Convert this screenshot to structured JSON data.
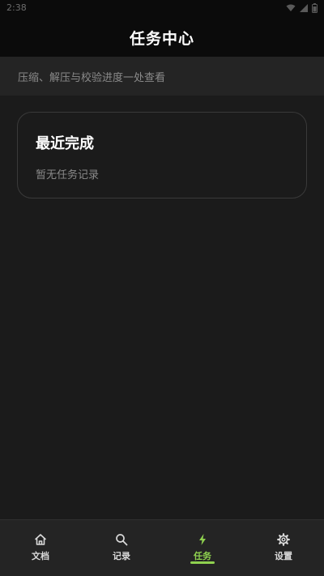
{
  "status_bar": {
    "time": "2:38",
    "icons": [
      "wifi-icon",
      "signal-icon",
      "battery-icon"
    ]
  },
  "app_bar": {
    "title": "任务中心"
  },
  "subtitle": "压缩、解压与校验进度一处查看",
  "recent_card": {
    "title": "最近完成",
    "empty_text": "暂无任务记录"
  },
  "bottom_nav": {
    "items": [
      {
        "label": "文档",
        "icon": "home-icon",
        "active": false
      },
      {
        "label": "记录",
        "icon": "search-icon",
        "active": false
      },
      {
        "label": "任务",
        "icon": "lightning-icon",
        "active": true
      },
      {
        "label": "设置",
        "icon": "gear-icon",
        "active": false
      }
    ]
  },
  "colors": {
    "background": "#1b1b1b",
    "header": "#0b0b0b",
    "strip": "#242424",
    "accent": "#8fd14f",
    "muted_text": "#8a8a8a"
  }
}
